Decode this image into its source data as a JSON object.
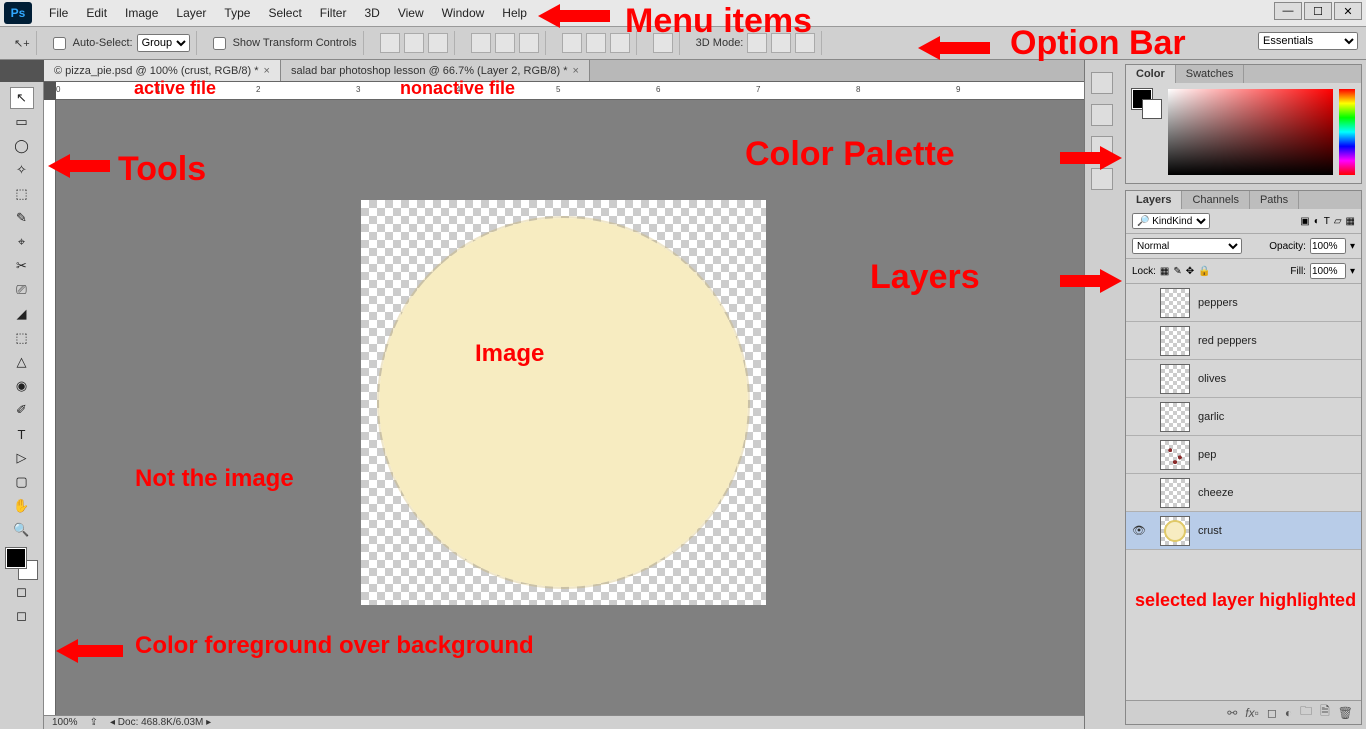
{
  "menu": {
    "items": [
      "File",
      "Edit",
      "Image",
      "Layer",
      "Type",
      "Select",
      "Filter",
      "3D",
      "View",
      "Window",
      "Help"
    ]
  },
  "options": {
    "autoSelectLabel": "Auto-Select:",
    "autoSelectTarget": "Group",
    "showTransform": "Show Transform Controls",
    "threeDMode": "3D Mode:",
    "workspace": "Essentials"
  },
  "tabs": [
    {
      "label": "© pizza_pie.psd @ 100% (crust, RGB/8) *",
      "active": true
    },
    {
      "label": "salad bar photoshop lesson @ 66.7% (Layer 2, RGB/8) *",
      "active": false
    }
  ],
  "status": {
    "zoom": "100%",
    "doc": "Doc: 468.8K/6.03M"
  },
  "colorPanel": {
    "tabs": [
      "Color",
      "Swatches"
    ]
  },
  "layersPanel": {
    "tabs": [
      "Layers",
      "Channels",
      "Paths"
    ],
    "filter": "Kind",
    "blend": "Normal",
    "opacityLabel": "Opacity:",
    "opacity": "100%",
    "lockLabel": "Lock:",
    "fillLabel": "Fill:",
    "fill": "100%",
    "layers": [
      {
        "name": "peppers",
        "visible": false,
        "sel": false,
        "thumb": "plain"
      },
      {
        "name": "red peppers",
        "visible": false,
        "sel": false,
        "thumb": "plain"
      },
      {
        "name": "olives",
        "visible": false,
        "sel": false,
        "thumb": "plain"
      },
      {
        "name": "garlic",
        "visible": false,
        "sel": false,
        "thumb": "plain"
      },
      {
        "name": "pep",
        "visible": false,
        "sel": false,
        "thumb": "pep"
      },
      {
        "name": "cheeze",
        "visible": false,
        "sel": false,
        "thumb": "plain"
      },
      {
        "name": "crust",
        "visible": true,
        "sel": true,
        "thumb": "crust"
      }
    ]
  },
  "tools": [
    "↖",
    "▭",
    "◯",
    "✧",
    "⬚",
    "✎",
    "⌖",
    "✂",
    "⎚",
    "◢",
    "⬚",
    "△",
    "◉",
    "✐",
    "T",
    "▷",
    "▢",
    "✋",
    "🔍"
  ],
  "annotations": {
    "menu": "Menu items",
    "option": "Option Bar",
    "tools": "Tools",
    "activeFile": "active file",
    "nonactiveFile": "nonactive file",
    "colorPalette": "Color Palette",
    "layers": "Layers",
    "image": "Image",
    "notImage": "Not the image",
    "fgbg": "Color foreground over background",
    "selLayer": "selected layer highlighted"
  },
  "rulerTicks": [
    "0",
    "1",
    "2",
    "3",
    "4",
    "5",
    "6",
    "7",
    "8",
    "9"
  ]
}
